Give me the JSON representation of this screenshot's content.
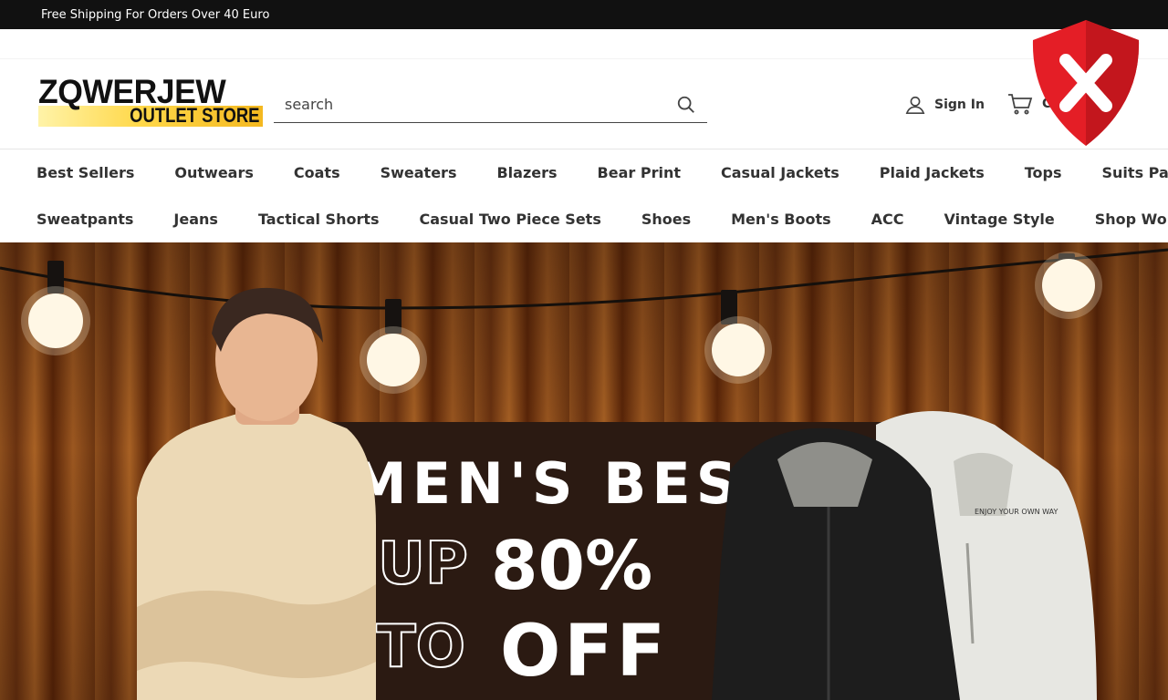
{
  "announcement": {
    "text": "Free Shipping For Orders Over 40 Euro"
  },
  "header": {
    "logo_top": "ZQWERJEW",
    "logo_bottom": "OUTLET STORE",
    "search_placeholder": "search",
    "signin_label": "Sign In",
    "cart_label": "Cart"
  },
  "nav": {
    "row1": [
      "Best Sellers",
      "Outwears",
      "Coats",
      "Sweaters",
      "Blazers",
      "Bear Print",
      "Casual Jackets",
      "Plaid Jackets",
      "Tops",
      "Suits Pants"
    ],
    "row2": [
      "Sweatpants",
      "Jeans",
      "Tactical Shorts",
      "Casual Two Piece Sets",
      "Shoes",
      "Men's Boots",
      "ACC",
      "Vintage Style",
      "Shop Women's"
    ]
  },
  "hero": {
    "line1": "MEN'S BEST",
    "up": "UP",
    "percent": "80%",
    "to": "TO",
    "off": "OFF",
    "jacket_print": "ENJOY YOUR OWN WAY"
  },
  "colors": {
    "topbar": "#111111",
    "brand_gold": "#f4b81f",
    "shield_red": "#e41e26"
  },
  "icons": {
    "search": "search-icon",
    "user": "user-icon",
    "cart": "cart-icon",
    "shield": "shield-x-icon"
  }
}
